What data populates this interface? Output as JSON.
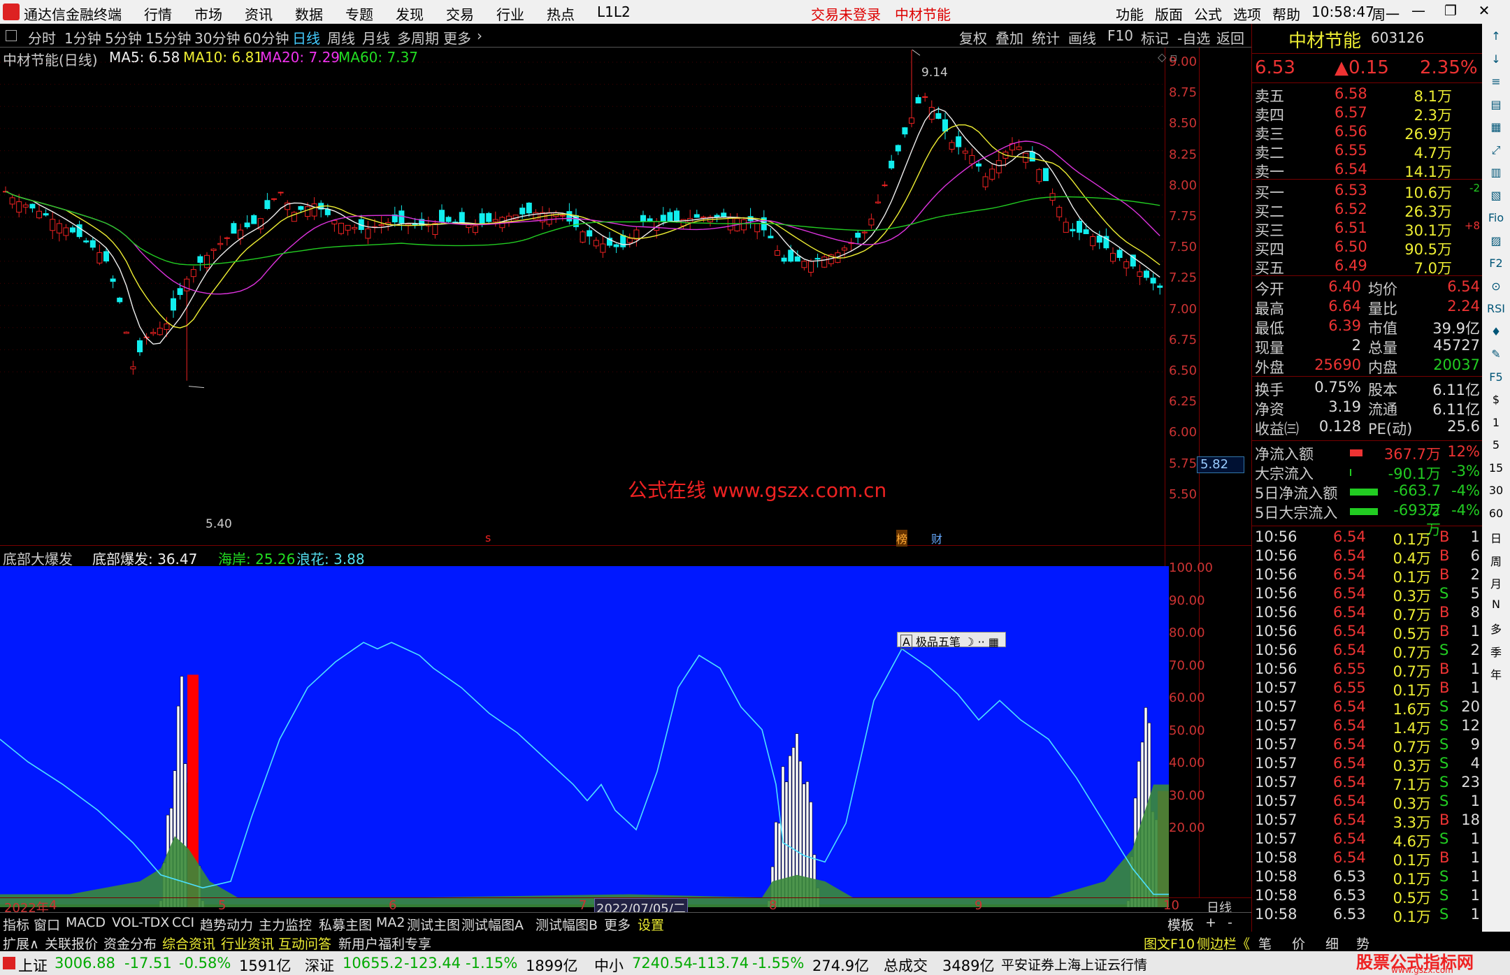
{
  "app": {
    "name": "通达信金融终端",
    "trade_status": "交易未登录",
    "stock_header": "中材节能",
    "clock": "10:58:47",
    "weekday": "周一"
  },
  "menu": [
    "行情",
    "市场",
    "资讯",
    "数据",
    "专题",
    "发现",
    "交易",
    "行业",
    "热点",
    "L1L2"
  ],
  "menu_right": [
    "功能",
    "版面",
    "公式",
    "选项",
    "帮助"
  ],
  "periods": [
    "分时",
    "1分钟",
    "5分钟",
    "15分钟",
    "30分钟",
    "60分钟",
    "日线",
    "周线",
    "月线",
    "多周期",
    "更多"
  ],
  "period_selected": "日线",
  "tools": [
    "复权",
    "叠加",
    "统计",
    "画线",
    "F10",
    "标记",
    "-自选",
    "返回"
  ],
  "main_legend": {
    "title": "中材节能(日线)",
    "ma5": "MA5: 6.58",
    "ma10": "MA10: 6.81",
    "ma20": "MA20: 7.29",
    "ma60": "MA60: 7.37"
  },
  "main_axis": [
    "9.00",
    "8.75",
    "8.50",
    "8.25",
    "8.00",
    "7.75",
    "7.50",
    "7.25",
    "7.00",
    "6.75",
    "6.50",
    "6.25",
    "6.00",
    "5.75",
    "5.50"
  ],
  "cur_price_tag": "5.82",
  "high_mark": "9.14",
  "low_mark": "5.40",
  "watermark": "公式在线  www.gszx.com.cn",
  "markers": {
    "s": "s",
    "bang": "榜",
    "cai": "财"
  },
  "ind_legend": {
    "title": "底部大爆发",
    "v1": "底部爆发: 36.47",
    "v2": "海岸: 25.26",
    "v3": "浪花: 3.88"
  },
  "ind_axis": [
    "100.00",
    "90.00",
    "80.00",
    "70.00",
    "60.00",
    "50.00",
    "40.00",
    "30.00",
    "20.00"
  ],
  "ime_label": "极品五笔",
  "date_axis": {
    "year": "2022年",
    "m4": "4",
    "m5": "5",
    "m6": "6",
    "m7": "7",
    "cursor_date": "2022/07/05/二",
    "m8": "8",
    "m9": "9",
    "m10": "10",
    "period": "日线"
  },
  "quote": {
    "name": "中材节能",
    "code": "603126",
    "price": "6.53",
    "change": "▲0.15",
    "pct": "2.35%"
  },
  "asks": [
    {
      "l": "卖五",
      "p": "6.58",
      "v": "8.1万"
    },
    {
      "l": "卖四",
      "p": "6.57",
      "v": "2.3万"
    },
    {
      "l": "卖三",
      "p": "6.56",
      "v": "26.9万"
    },
    {
      "l": "卖二",
      "p": "6.55",
      "v": "4.7万"
    },
    {
      "l": "卖一",
      "p": "6.54",
      "v": "14.1万"
    }
  ],
  "bids": [
    {
      "l": "买一",
      "p": "6.53",
      "v": "10.6万",
      "c": "-2"
    },
    {
      "l": "买二",
      "p": "6.52",
      "v": "26.3万",
      "c": ""
    },
    {
      "l": "买三",
      "p": "6.51",
      "v": "30.1万",
      "c": "+8"
    },
    {
      "l": "买四",
      "p": "6.50",
      "v": "90.5万",
      "c": ""
    },
    {
      "l": "买五",
      "p": "6.49",
      "v": "7.0万",
      "c": ""
    }
  ],
  "stats": [
    {
      "a": "今开",
      "av": "6.40",
      "b": "均价",
      "bv": "6.54"
    },
    {
      "a": "最高",
      "av": "6.64",
      "b": "量比",
      "bv": "2.24"
    },
    {
      "a": "最低",
      "av": "6.39",
      "b": "市值",
      "bv": "39.9亿"
    },
    {
      "a": "现量",
      "av": "2",
      "b": "总量",
      "bv": "45727"
    },
    {
      "a": "外盘",
      "av": "25690",
      "b": "内盘",
      "bv": "20037"
    }
  ],
  "stats2": [
    {
      "a": "换手",
      "av": "0.75%",
      "b": "股本",
      "bv": "6.11亿"
    },
    {
      "a": "净资",
      "av": "3.19",
      "b": "流通",
      "bv": "6.11亿"
    },
    {
      "a": "收益㈢",
      "av": "0.128",
      "b": "PE(动)",
      "bv": "25.6"
    }
  ],
  "flows": [
    {
      "l": "净流入额",
      "v": "367.7万",
      "p": "12%"
    },
    {
      "l": "大宗流入",
      "v": "-90.1万",
      "p": "-3%"
    },
    {
      "l": "5日净流入额",
      "v": "-663.7万",
      "p": "-4%"
    },
    {
      "l": "5日大宗流入",
      "v": "-693.2万",
      "p": "-4%"
    }
  ],
  "ticks": [
    [
      "10:56",
      "6.54",
      "0.1万",
      "B",
      "1"
    ],
    [
      "10:56",
      "6.54",
      "0.4万",
      "B",
      "6"
    ],
    [
      "10:56",
      "6.54",
      "0.1万",
      "B",
      "2"
    ],
    [
      "10:56",
      "6.54",
      "0.3万",
      "S",
      "5"
    ],
    [
      "10:56",
      "6.54",
      "0.7万",
      "B",
      "8"
    ],
    [
      "10:56",
      "6.54",
      "0.5万",
      "B",
      "1"
    ],
    [
      "10:56",
      "6.54",
      "0.7万",
      "S",
      "2"
    ],
    [
      "10:56",
      "6.55",
      "0.7万",
      "B",
      "1"
    ],
    [
      "10:57",
      "6.55",
      "0.1万",
      "B",
      "1"
    ],
    [
      "10:57",
      "6.54",
      "1.6万",
      "S",
      "20"
    ],
    [
      "10:57",
      "6.54",
      "1.4万",
      "S",
      "12"
    ],
    [
      "10:57",
      "6.54",
      "0.7万",
      "S",
      "9"
    ],
    [
      "10:57",
      "6.54",
      "0.3万",
      "S",
      "4"
    ],
    [
      "10:57",
      "6.54",
      "7.1万",
      "S",
      "23"
    ],
    [
      "10:57",
      "6.54",
      "0.3万",
      "S",
      "1"
    ],
    [
      "10:57",
      "6.54",
      "3.3万",
      "B",
      "18"
    ],
    [
      "10:57",
      "6.54",
      "4.6万",
      "S",
      "1"
    ],
    [
      "10:58",
      "6.54",
      "0.1万",
      "B",
      "1"
    ],
    [
      "10:58",
      "6.53",
      "0.1万",
      "S",
      "1"
    ],
    [
      "10:58",
      "6.53",
      "0.5万",
      "S",
      "1"
    ],
    [
      "10:58",
      "6.53",
      "0.1万",
      "S",
      "1"
    ]
  ],
  "ind_tabs": [
    "指标",
    "窗口",
    "MACD",
    "VOL-TDX",
    "CCI",
    "趋势动力",
    "主力监控",
    "私募主图",
    "MA2",
    "测试主图",
    "测试幅图A",
    "测试幅图B",
    "更多",
    "设置"
  ],
  "ind_tabs_right": [
    "模板",
    "+",
    "-"
  ],
  "tabs2": [
    "扩展∧",
    "关联报价",
    "资金分布",
    "综合资讯",
    "行业资讯",
    "互动问答",
    "新用户福利专享"
  ],
  "tabs2_right": [
    "图文F10",
    "侧边栏《",
    "笔",
    "价",
    "细",
    "势"
  ],
  "status": {
    "sh": "上证",
    "sh_v": "3006.88",
    "sh_c": "-17.51",
    "sh_p": "-0.58%",
    "sh_a": "1591亿",
    "sz": "深证",
    "sz_v": "10655.2",
    "sz_c": "-123.44",
    "sz_p": "-1.15%",
    "sz_a": "1899亿",
    "zx": "中小",
    "zx_v": "7240.54",
    "zx_c": "-113.74",
    "zx_p": "-1.55%",
    "zx_a": "274.9亿",
    "tot": "总成交",
    "tot_v": "3489亿",
    "broker": "平安证券上海上证云行情",
    "brand": "股票公式指标网",
    "brand_url": "www.gszx.com"
  },
  "sidebar": [
    "↑",
    "↓",
    "≡",
    "▤",
    "▦",
    "⤢",
    "▥",
    "▧",
    "Fio",
    "▨",
    "F2",
    "⊙",
    "RSI",
    "♦",
    "✎",
    "F5",
    "$",
    "1",
    "5",
    "15",
    "30",
    "60",
    "日",
    "周",
    "月",
    "N",
    "多",
    "季",
    "年"
  ]
}
